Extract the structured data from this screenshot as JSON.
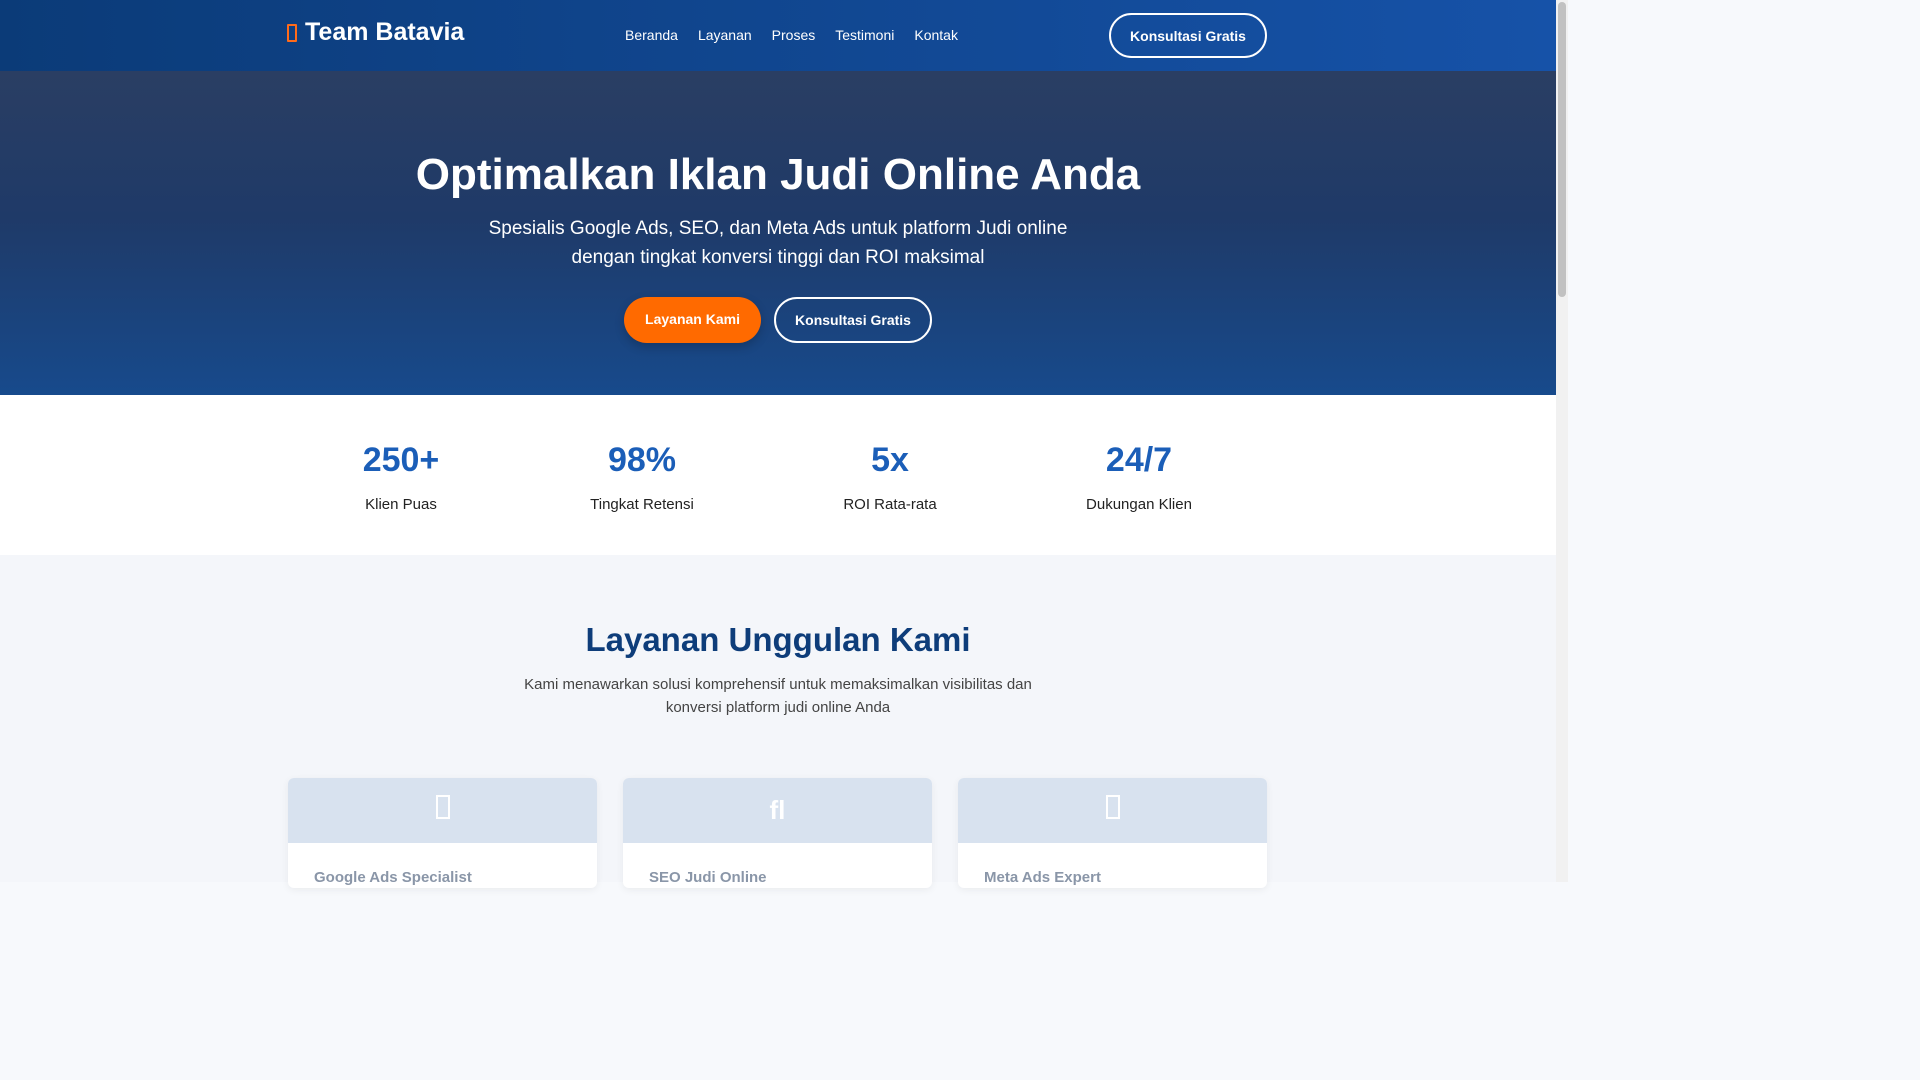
{
  "nav": {
    "brand": "Team Batavia",
    "links": [
      "Beranda",
      "Layanan",
      "Proses",
      "Testimoni",
      "Kontak"
    ],
    "cta": "Konsultasi Gratis"
  },
  "hero": {
    "title": "Optimalkan Iklan Judi Online Anda",
    "subtitle": "Spesialis Google Ads, SEO, dan Meta Ads untuk platform Judi online dengan tingkat konversi tinggi dan ROI maksimal",
    "primary_button": "Layanan Kami",
    "secondary_button": "Konsultasi Gratis"
  },
  "stats": [
    {
      "value": "250+",
      "label": "Klien Puas"
    },
    {
      "value": "98%",
      "label": "Tingkat Retensi"
    },
    {
      "value": "5x",
      "label": "ROI Rata-rata"
    },
    {
      "value": "24/7",
      "label": "Dukungan Klien"
    }
  ],
  "services": {
    "title": "Layanan Unggulan Kami",
    "description": "Kami menawarkan solusi komprehensif untuk memaksimalkan visibilitas dan konversi platform judi online Anda",
    "cards": [
      {
        "icon": "google-icon",
        "title": "Google Ads Specialist"
      },
      {
        "icon": "search-icon",
        "title": "SEO Judi Online"
      },
      {
        "icon": "meta-icon",
        "title": "Meta Ads Expert"
      }
    ]
  },
  "colors": {
    "primary": "#1652a8",
    "accent": "#ff6a00",
    "heading": "#0e3d7a"
  }
}
